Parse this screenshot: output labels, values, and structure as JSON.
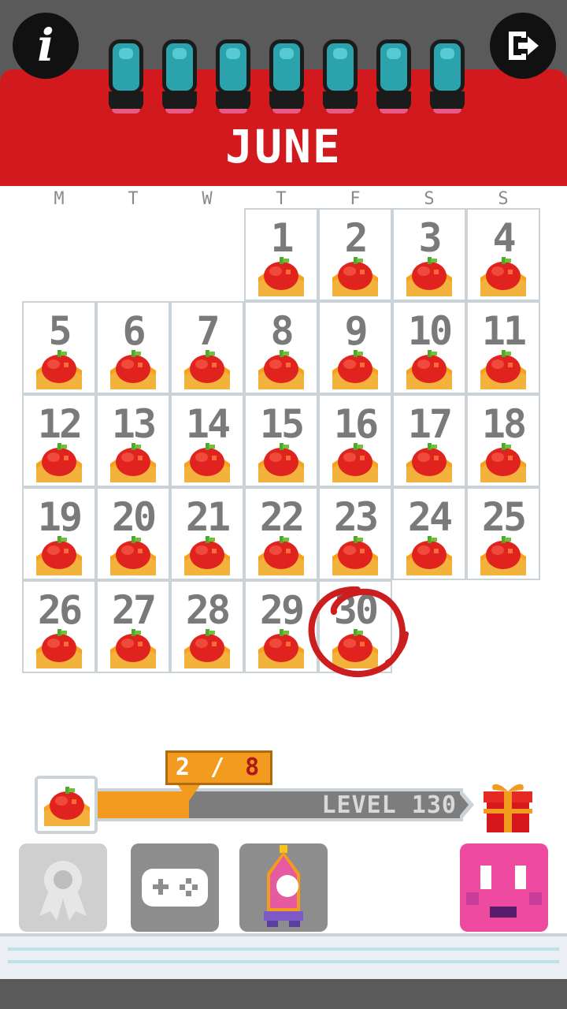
{
  "header": {
    "month": "JUNE",
    "info_icon": "i",
    "exit_icon": "exit-icon",
    "ring_count": 7
  },
  "weekdays": [
    "M",
    "T",
    "W",
    "T",
    "F",
    "S",
    "S"
  ],
  "calendar": {
    "days": [
      {
        "day": "1",
        "col": 3,
        "row": 0
      },
      {
        "day": "2",
        "col": 4,
        "row": 0
      },
      {
        "day": "3",
        "col": 5,
        "row": 0
      },
      {
        "day": "4",
        "col": 6,
        "row": 0
      },
      {
        "day": "5",
        "col": 0,
        "row": 1
      },
      {
        "day": "6",
        "col": 1,
        "row": 1
      },
      {
        "day": "7",
        "col": 2,
        "row": 1
      },
      {
        "day": "8",
        "col": 3,
        "row": 1
      },
      {
        "day": "9",
        "col": 4,
        "row": 1
      },
      {
        "day": "10",
        "col": 5,
        "row": 1
      },
      {
        "day": "11",
        "col": 6,
        "row": 1
      },
      {
        "day": "12",
        "col": 0,
        "row": 2
      },
      {
        "day": "13",
        "col": 1,
        "row": 2
      },
      {
        "day": "14",
        "col": 2,
        "row": 2
      },
      {
        "day": "15",
        "col": 3,
        "row": 2
      },
      {
        "day": "16",
        "col": 4,
        "row": 2
      },
      {
        "day": "17",
        "col": 5,
        "row": 2
      },
      {
        "day": "18",
        "col": 6,
        "row": 2
      },
      {
        "day": "19",
        "col": 0,
        "row": 3
      },
      {
        "day": "20",
        "col": 1,
        "row": 3
      },
      {
        "day": "21",
        "col": 2,
        "row": 3
      },
      {
        "day": "22",
        "col": 3,
        "row": 3
      },
      {
        "day": "23",
        "col": 4,
        "row": 3
      },
      {
        "day": "24",
        "col": 5,
        "row": 3
      },
      {
        "day": "25",
        "col": 6,
        "row": 3
      },
      {
        "day": "26",
        "col": 0,
        "row": 4
      },
      {
        "day": "27",
        "col": 1,
        "row": 4
      },
      {
        "day": "28",
        "col": 2,
        "row": 4
      },
      {
        "day": "29",
        "col": 3,
        "row": 4
      },
      {
        "day": "30",
        "col": 4,
        "row": 4
      }
    ],
    "completed_icon": "apple-icon",
    "today": "30"
  },
  "progress": {
    "current": "2",
    "separator": "/",
    "total": "8",
    "fraction": 0.25,
    "level_label": "LEVEL 130",
    "reward_icon": "gift-icon"
  },
  "toolbar": {
    "buttons": [
      "ribbon-icon",
      "gamepad-icon",
      "character-icon",
      "face-icon"
    ]
  },
  "colors": {
    "header_red": "#d21a1e",
    "ring_teal": "#2ba3ad",
    "progress_orange": "#f39b1e",
    "face_pink": "#ee4aa0",
    "number_gray": "#7a7a7a"
  }
}
